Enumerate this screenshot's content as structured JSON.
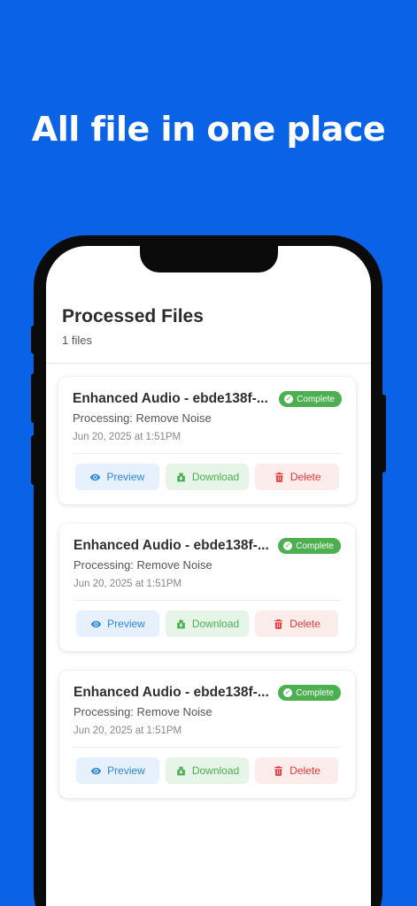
{
  "hero": {
    "headline": "All file in one place"
  },
  "header": {
    "title": "Processed Files",
    "count_text": "1 files"
  },
  "files": [
    {
      "name": "Enhanced Audio - ebde138f-...",
      "status": "Complete",
      "processing": "Processing: Remove Noise",
      "date": "Jun 20, 2025 at 1:51PM",
      "preview_label": "Preview",
      "download_label": "Download",
      "delete_label": "Delete"
    },
    {
      "name": "Enhanced Audio - ebde138f-...",
      "status": "Complete",
      "processing": "Processing: Remove Noise",
      "date": "Jun 20, 2025 at 1:51PM",
      "preview_label": "Preview",
      "download_label": "Download",
      "delete_label": "Delete"
    },
    {
      "name": "Enhanced Audio - ebde138f-...",
      "status": "Complete",
      "processing": "Processing: Remove Noise",
      "date": "Jun 20, 2025 at 1:51PM",
      "preview_label": "Preview",
      "download_label": "Download",
      "delete_label": "Delete"
    }
  ],
  "icons": {
    "preview": "eye-icon",
    "download": "download-icon",
    "delete": "trash-icon",
    "status": "check-circle-icon"
  },
  "colors": {
    "background": "#0A63E6",
    "complete": "#4CAF50",
    "preview": "#2E86DE",
    "download": "#4CAF50",
    "delete": "#E53935"
  }
}
